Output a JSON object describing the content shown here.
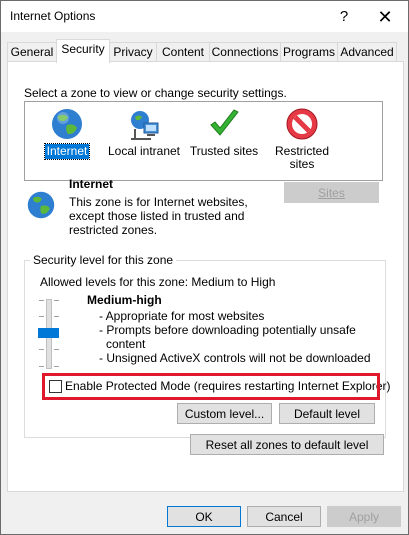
{
  "window": {
    "title": "Internet Options",
    "help_glyph": "?",
    "close_glyph": "✕"
  },
  "tabs": [
    {
      "label": "General"
    },
    {
      "label": "Security",
      "active": true
    },
    {
      "label": "Privacy"
    },
    {
      "label": "Content"
    },
    {
      "label": "Connections"
    },
    {
      "label": "Programs"
    },
    {
      "label": "Advanced"
    }
  ],
  "security": {
    "select_zone_text": "Select a zone to view or change security settings.",
    "zones": [
      {
        "label": "Internet",
        "icon": "globe-icon",
        "selected": true
      },
      {
        "label": "Local intranet",
        "icon": "network-icon"
      },
      {
        "label": "Trusted sites",
        "icon": "checkmark-icon"
      },
      {
        "label_line1": "Restricted",
        "label_line2": "sites",
        "icon": "restricted-icon"
      }
    ],
    "zone_info": {
      "title": "Internet",
      "desc_line1": "This zone is for Internet websites,",
      "desc_line2": "except those listed in trusted and",
      "desc_line3": "restricted zones."
    },
    "sites_button": "Sites",
    "group_title": "Security level for this zone",
    "allowed_levels": "Allowed levels for this zone: Medium to High",
    "level_name": "Medium-high",
    "level_points": [
      "- Appropriate for most websites",
      "- Prompts before downloading potentially unsafe",
      "content",
      "- Unsigned ActiveX controls will not be downloaded"
    ],
    "protected_mode_label": "Enable Protected Mode (requires restarting Internet Explorer)",
    "protected_mode_checked": false,
    "custom_level_button": "Custom level...",
    "default_level_button": "Default level",
    "reset_all_button": "Reset all zones to default level"
  },
  "footer": {
    "ok": "OK",
    "cancel": "Cancel",
    "apply": "Apply"
  },
  "colors": {
    "accent": "#0078d7",
    "highlight_border": "#e0182b"
  }
}
